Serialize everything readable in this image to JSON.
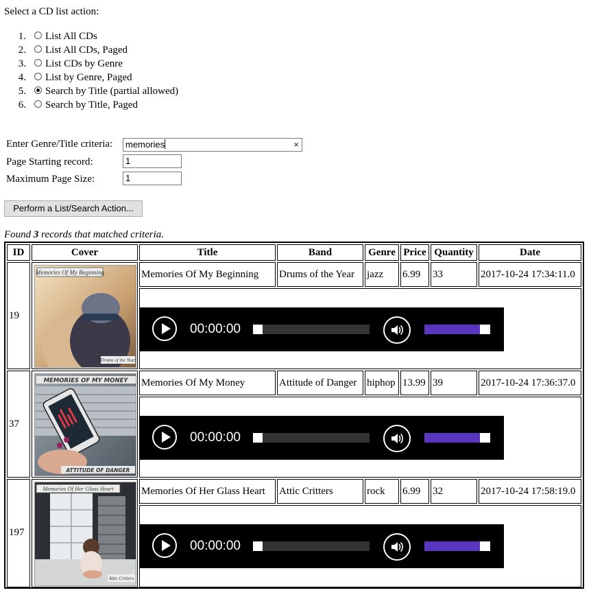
{
  "prompt": "Select a CD list action:",
  "actions": [
    {
      "num": "1.",
      "label": "List All CDs",
      "selected": false
    },
    {
      "num": "2.",
      "label": "List All CDs, Paged",
      "selected": false
    },
    {
      "num": "3.",
      "label": "List CDs by Genre",
      "selected": false
    },
    {
      "num": "4.",
      "label": "List by Genre, Paged",
      "selected": false
    },
    {
      "num": "5.",
      "label": "Search by Title (partial allowed)",
      "selected": true
    },
    {
      "num": "6.",
      "label": "Search by Title, Paged",
      "selected": false
    }
  ],
  "form": {
    "criteria_label": "Enter Genre/Title criteria:",
    "criteria_value": "memories",
    "clear_icon": "×",
    "start_label": "Page Starting record:",
    "start_value": "1",
    "size_label": "Maximum Page Size:",
    "size_value": "1",
    "action_button": "Perform a List/Search Action..."
  },
  "found": {
    "prefix": "Found ",
    "count": "3",
    "suffix": " records that matched criteria."
  },
  "table": {
    "headers": [
      "ID",
      "Cover",
      "Title",
      "Band",
      "Genre",
      "Price",
      "Quantity",
      "Date"
    ],
    "rows": [
      {
        "id": "19",
        "cover_title": "Memories Of My Beginning",
        "cover_band": "Drums of the Year",
        "title": "Memories Of My Beginning",
        "band": "Drums of the Year",
        "genre": "jazz",
        "price": "6.99",
        "quantity": "33",
        "date": "2017-10-24 17:34:11.0",
        "player_time": "00:00:00"
      },
      {
        "id": "37",
        "cover_title": "MEMORIES OF MY MONEY",
        "cover_band": "ATTITUDE OF DANGER",
        "title": "Memories Of My Money",
        "band": "Attitude of Danger",
        "genre": "hiphop",
        "price": "13.99",
        "quantity": "39",
        "date": "2017-10-24 17:36:37.0",
        "player_time": "00:00:00"
      },
      {
        "id": "197",
        "cover_title": "Memories Of Her Glass Heart",
        "cover_band": "Attic Critters",
        "title": "Memories Of Her Glass Heart",
        "band": "Attic Critters",
        "genre": "rock",
        "price": "6.99",
        "quantity": "32",
        "date": "2017-10-24 17:58:19.0",
        "player_time": "00:00:00"
      }
    ]
  },
  "player": {
    "play_icon": "play-icon",
    "volume_icon": "speaker-icon",
    "seek_fraction": 0,
    "volume_fraction": 1
  },
  "colors": {
    "player_bg": "#000000",
    "volume_bar": "#5a36c0"
  }
}
